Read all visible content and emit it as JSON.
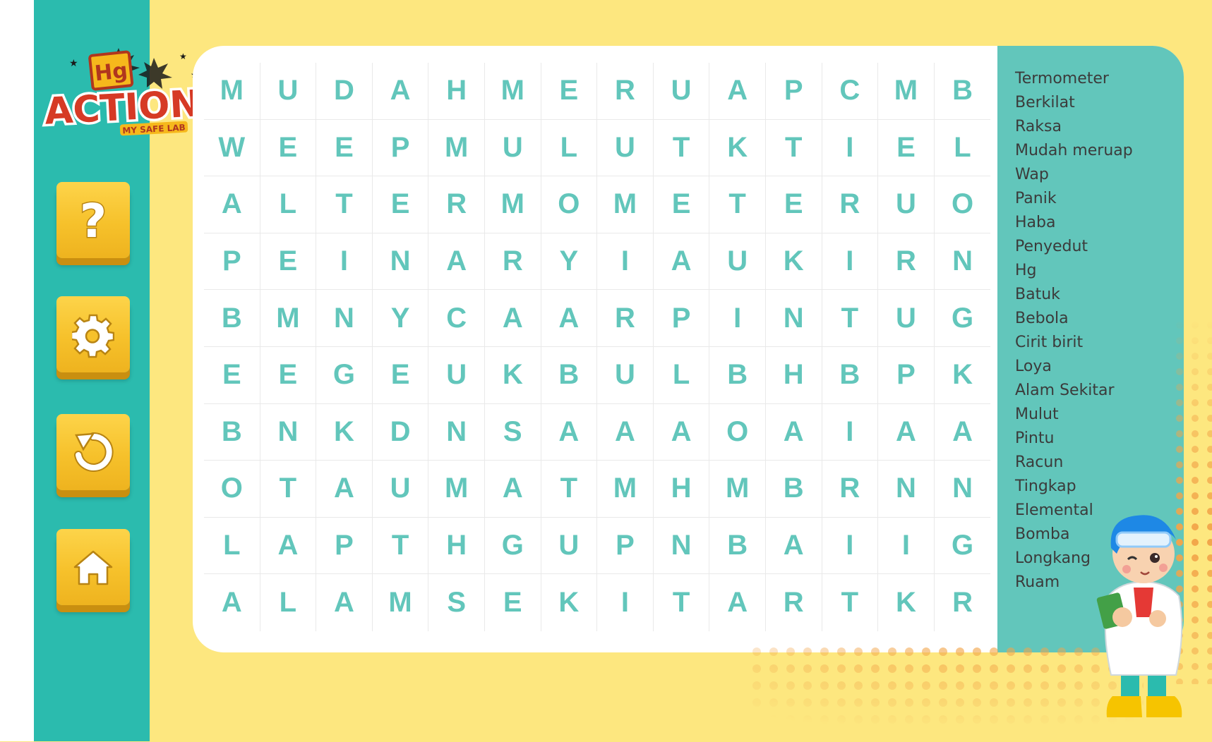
{
  "logo": {
    "symbol": "Hg",
    "title": "ACTION",
    "subtitle": "MY SAFE LAB"
  },
  "sidebar": {
    "buttons": [
      {
        "name": "help",
        "icon": "question-icon"
      },
      {
        "name": "settings",
        "icon": "gear-icon"
      },
      {
        "name": "restart",
        "icon": "restart-icon"
      },
      {
        "name": "home",
        "icon": "home-icon"
      }
    ]
  },
  "grid": {
    "rows": [
      [
        "M",
        "U",
        "D",
        "A",
        "H",
        "M",
        "E",
        "R",
        "U",
        "A",
        "P",
        "C",
        "M",
        "B"
      ],
      [
        "W",
        "E",
        "E",
        "P",
        "M",
        "U",
        "L",
        "U",
        "T",
        "K",
        "T",
        "I",
        "E",
        "L"
      ],
      [
        "A",
        "L",
        "T",
        "E",
        "R",
        "M",
        "O",
        "M",
        "E",
        "T",
        "E",
        "R",
        "U",
        "O"
      ],
      [
        "P",
        "E",
        "I",
        "N",
        "A",
        "R",
        "Y",
        "I",
        "A",
        "U",
        "K",
        "I",
        "R",
        "N"
      ],
      [
        "B",
        "M",
        "N",
        "Y",
        "C",
        "A",
        "A",
        "R",
        "P",
        "I",
        "N",
        "T",
        "U",
        "G"
      ],
      [
        "E",
        "E",
        "G",
        "E",
        "U",
        "K",
        "B",
        "U",
        "L",
        "B",
        "H",
        "B",
        "P",
        "K"
      ],
      [
        "B",
        "N",
        "K",
        "D",
        "N",
        "S",
        "A",
        "A",
        "A",
        "O",
        "A",
        "I",
        "A",
        "A"
      ],
      [
        "O",
        "T",
        "A",
        "U",
        "M",
        "A",
        "T",
        "M",
        "H",
        "M",
        "B",
        "R",
        "N",
        "N"
      ],
      [
        "L",
        "A",
        "P",
        "T",
        "H",
        "G",
        "U",
        "P",
        "N",
        "B",
        "A",
        "I",
        "I",
        "G"
      ],
      [
        "A",
        "L",
        "A",
        "M",
        "S",
        "E",
        "K",
        "I",
        "T",
        "A",
        "R",
        "T",
        "K",
        "R"
      ]
    ]
  },
  "word_list": [
    "Termometer",
    "Berkilat",
    "Raksa",
    "Mudah meruap",
    "Wap",
    "Panik",
    "Haba",
    "Penyedut",
    "Hg",
    "Batuk",
    "Bebola",
    "Cirit birit",
    "Loya",
    "Alam Sekitar",
    "Mulut",
    "Pintu",
    "Racun",
    "Tingkap",
    "Elemental",
    "Bomba",
    "Longkang",
    "Ruam"
  ],
  "colors": {
    "background": "#fde77f",
    "sidebar": "#2bbbae",
    "letters": "#62c6bb",
    "word_panel": "#62c6bb",
    "button": "#f6c12b"
  }
}
